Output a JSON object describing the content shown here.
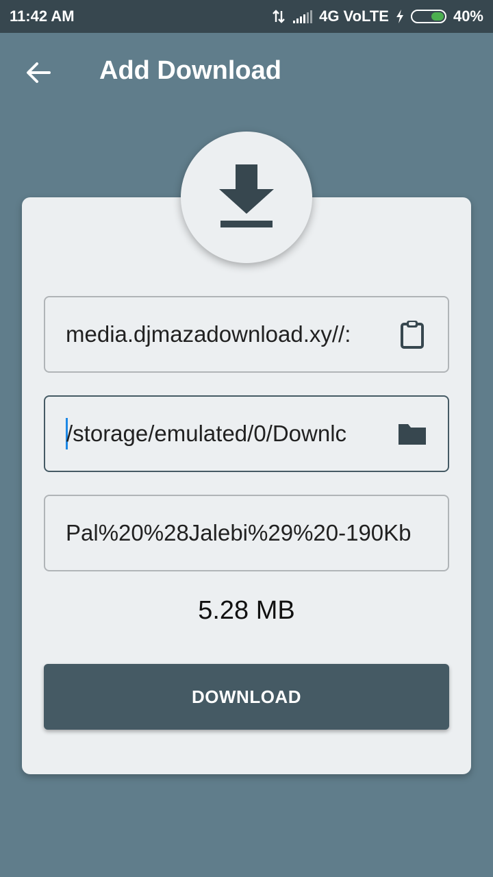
{
  "status_bar": {
    "time": "11:42 AM",
    "network": "4G VoLTE",
    "battery": "40%",
    "battery_level": 0.4
  },
  "appbar": {
    "back_icon": "arrow-back-icon",
    "title": "Add Download"
  },
  "header_icon": "download-icon",
  "form": {
    "url_field": {
      "value": "://media.djmazadownload.xy",
      "icon": "clipboard-icon"
    },
    "path_field": {
      "value": "/storage/emulated/0/Downlc",
      "icon": "folder-icon"
    },
    "filename_field": {
      "value": "Pal%20%28Jalebi%29%20-190Kb"
    },
    "file_size": "5.28 MB",
    "download_label": "DOWNLOAD"
  },
  "colors": {
    "background": "#607d8b",
    "status_bar": "#37474f",
    "card": "#eceff1",
    "button": "#455a64",
    "battery_fill": "#4caf50"
  }
}
